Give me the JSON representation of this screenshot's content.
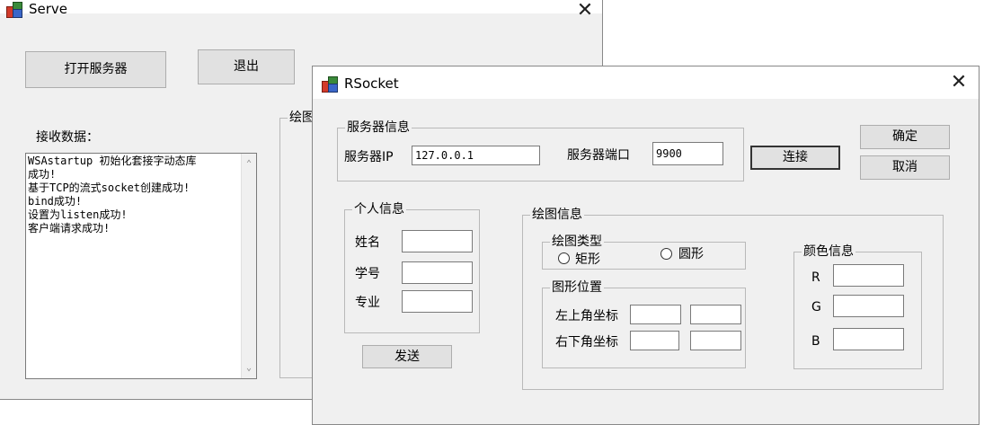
{
  "serve": {
    "title": "Serve",
    "open_button": "打开服务器",
    "exit_button": "退出",
    "receive_label": "接收数据：",
    "log_lines": [
      "WSAstartup 初始化套接字动态库",
      "成功!",
      "基于TCP的流式socket创建成功!",
      "bind成功!",
      "设置为listen成功!",
      "客户端请求成功!"
    ],
    "drawing_group": "绘图"
  },
  "rsocket": {
    "title": "RSocket",
    "server_group": "服务器信息",
    "server_ip_label": "服务器IP",
    "server_ip_value": "127.0.0.1",
    "server_port_label": "服务器端口",
    "server_port_value": "9900",
    "connect_button": "连接",
    "ok_button": "确定",
    "cancel_button": "取消",
    "personal_group": "个人信息",
    "name_label": "姓名",
    "name_value": "",
    "student_id_label": "学号",
    "student_id_value": "",
    "major_label": "专业",
    "major_value": "",
    "send_button": "发送",
    "drawing_group": "绘图信息",
    "shape_type_group": "绘图类型",
    "rect_option": "矩形",
    "circle_option": "圆形",
    "position_group": "图形位置",
    "top_left_label": "左上角坐标",
    "bottom_right_label": "右下角坐标",
    "color_group": "颜色信息",
    "r_label": "R",
    "g_label": "G",
    "b_label": "B"
  }
}
